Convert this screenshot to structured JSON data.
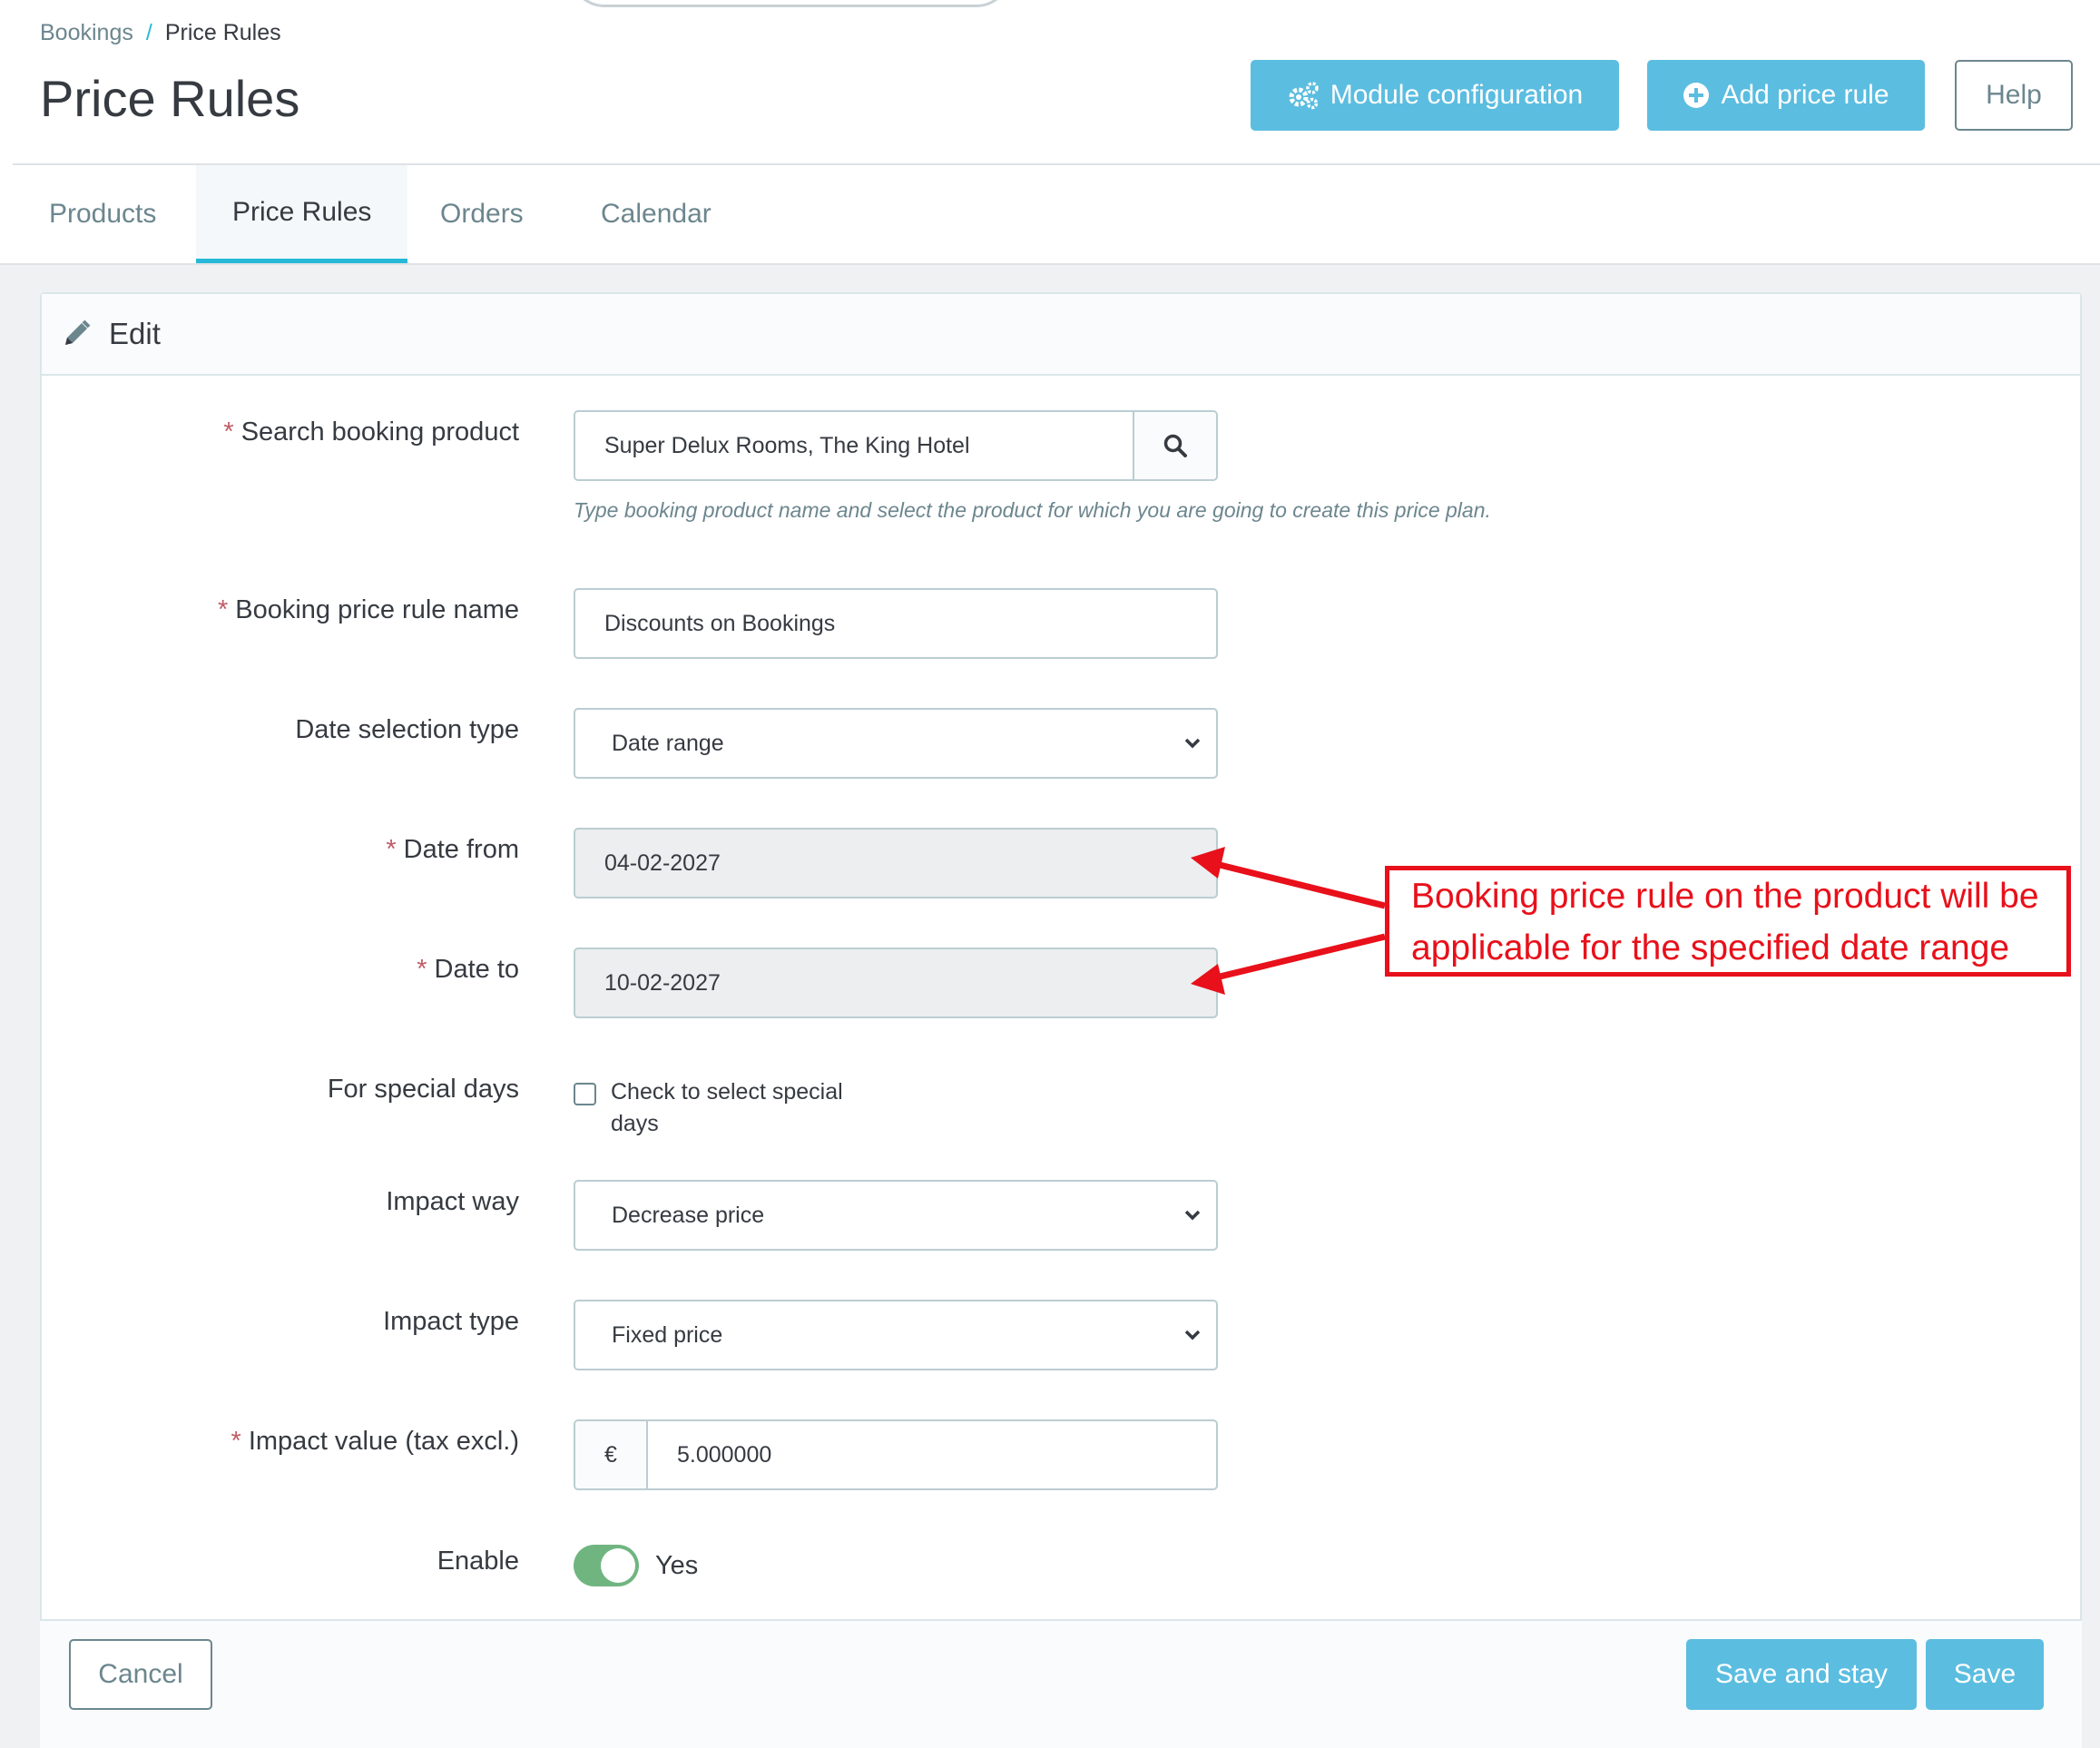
{
  "breadcrumb": {
    "parent": "Bookings",
    "separator": "/",
    "current": "Price Rules"
  },
  "page_title": "Price Rules",
  "header_buttons": {
    "module_config": "Module configuration",
    "add_price_rule": "Add price rule",
    "help": "Help"
  },
  "tabs": [
    {
      "label": "Products",
      "active": false
    },
    {
      "label": "Price Rules",
      "active": true
    },
    {
      "label": "Orders",
      "active": false
    },
    {
      "label": "Calendar",
      "active": false
    }
  ],
  "panel": {
    "title": "Edit"
  },
  "form": {
    "search_product": {
      "label": "Search booking product",
      "required": true,
      "value": "Super Delux Rooms, The King Hotel",
      "help": "Type booking product name and select the product for which you are going to create this price plan."
    },
    "rule_name": {
      "label": "Booking price rule name",
      "required": true,
      "value": "Discounts on Bookings"
    },
    "date_selection_type": {
      "label": "Date selection type",
      "value": "Date range"
    },
    "date_from": {
      "label": "Date from",
      "required": true,
      "value": "04-02-2027"
    },
    "date_to": {
      "label": "Date to",
      "required": true,
      "value": "10-02-2027"
    },
    "special_days": {
      "label": "For special days",
      "checkbox_label": "Check to select special days",
      "checked": false
    },
    "impact_way": {
      "label": "Impact way",
      "value": "Decrease price"
    },
    "impact_type": {
      "label": "Impact type",
      "value": "Fixed price"
    },
    "impact_value": {
      "label": "Impact value (tax excl.)",
      "required": true,
      "currency": "€",
      "value": "5.000000"
    },
    "enable": {
      "label": "Enable",
      "value": "Yes",
      "on": true
    }
  },
  "footer_buttons": {
    "cancel": "Cancel",
    "save_and_stay": "Save and stay",
    "save": "Save"
  },
  "annotation": {
    "line1": "Booking price rule on the product will be",
    "line2": "applicable for the specified date range"
  },
  "colors": {
    "accent": "#25b9d7",
    "button_info": "#5bbde0",
    "switch_on": "#70b580",
    "required": "#c05c67",
    "annotation": "#e8101a"
  }
}
